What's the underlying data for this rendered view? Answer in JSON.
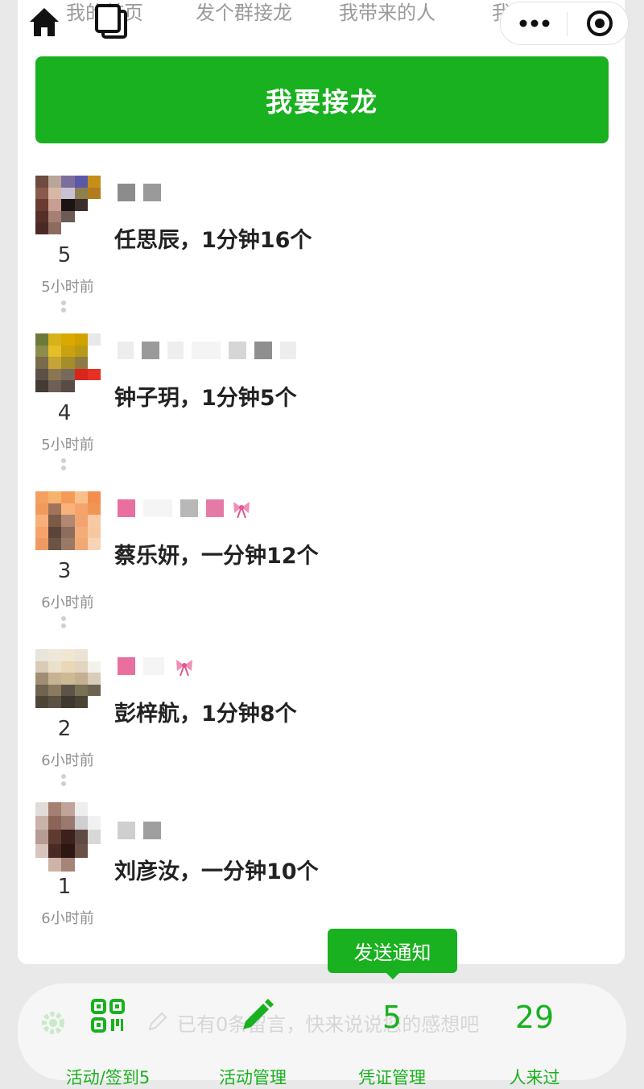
{
  "top_nav": {
    "tabs": [
      "我的首页",
      "发个群接龙",
      "我带来的人",
      "我的凭证"
    ]
  },
  "join_button": "我要接龙",
  "entries": [
    {
      "rank": "5",
      "time": "5小时前",
      "content": "任思辰，1分钟16个"
    },
    {
      "rank": "4",
      "time": "5小时前",
      "content": "钟子玥，1分钟5个"
    },
    {
      "rank": "3",
      "time": "6小时前",
      "content": "蔡乐妍，一分钟12个"
    },
    {
      "rank": "2",
      "time": "6小时前",
      "content": "彭梓航，1分钟8个"
    },
    {
      "rank": "1",
      "time": "6小时前",
      "content": "刘彦汝，一分钟10个"
    }
  ],
  "tooltip": "发送通知",
  "comment_placeholder": "已有0条留言，快来说说您的感想吧",
  "bottom_tabs": {
    "activity_label": "活动/签到5",
    "manage_label": "活动管理",
    "voucher_count": "5",
    "voucher_label": "凭证管理",
    "visitors_count": "29",
    "visitors_label": "人来过"
  },
  "colors": {
    "accent": "#19b11f",
    "background": "#e9e9e9"
  },
  "icons": [
    "home-icon",
    "pages-icon",
    "more-dots-icon",
    "target-icon",
    "qr-code-icon",
    "pencil-icon",
    "gear-icon"
  ]
}
